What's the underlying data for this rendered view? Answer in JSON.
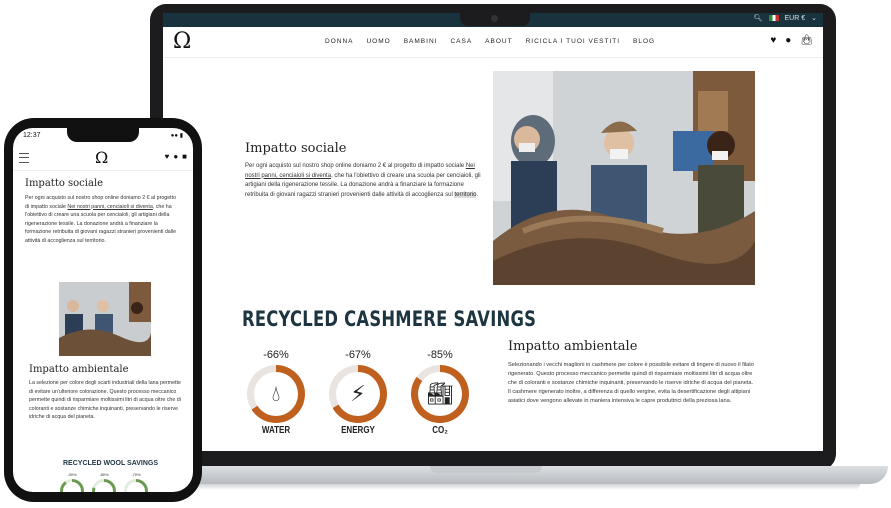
{
  "desktop": {
    "topbar": {
      "lang": "EUR €"
    },
    "nav": {
      "logo": "Ω",
      "items": [
        "DONNA",
        "UOMO",
        "BAMBINI",
        "CASA",
        "ABOUT",
        "RICICLA I TUOI VESTITI",
        "BLOG"
      ]
    },
    "social": {
      "title": "Impatto sociale",
      "text_1": "Per ogni acquisto sul nostro shop online doniamo 2 € al progetto di impatto sociale ",
      "link": "Nei nostri panni, cenciaioli si diventa",
      "text_2": ", che ha l'obiettivo di creare una scuola per cenciaioli, gli artigiani della rigenerazione tessile. La donazione andrà a finanziare la formazione retribuita di giovani ragazzi stranieri provenienti dalle attività di accoglienza sul ",
      "highlight": "territorio",
      "text_3": "."
    },
    "cashmere": {
      "title": "RECYCLED CASHMERE SAVINGS",
      "stats": [
        {
          "pct": "-66%",
          "value": 66,
          "label": "WATER",
          "icon": "water-drops-icon"
        },
        {
          "pct": "-67%",
          "value": 67,
          "label": "ENERGY",
          "icon": "plug-icon"
        },
        {
          "pct": "-85%",
          "value": 85,
          "label": "CO₂",
          "icon": "factory-icon"
        }
      ]
    },
    "environment": {
      "title": "Impatto ambientale",
      "text": "Selezionando i vecchi maglioni in cashmere per colore è possibile evitare di tingere di nuovo il filato rigenerato. Questo processo meccanico permette quindi di risparmiare moltissimi litri di acqua oltre che di coloranti e sostanze chimiche inquinanti, preservando le riserve idriche di acqua del pianeta. Il cashmere rigenerato inoltre, a differenza di quello vergine, evita la desertificazione degli altipiani asiatici dove vengono allevate in maniera intensiva le capre produttrici della preziosa lana."
    }
  },
  "mobile": {
    "time": "12:37",
    "logo": "Ω",
    "social": {
      "title": "Impatto sociale",
      "text_1": "Per ogni acquisto sul nostro shop online doniamo 2 € al progetto di impatto sociale ",
      "link": "Nei nostri panni, cenciaioli si diventa",
      "text_2": ", che ha l'obiettivo di creare una scuola per cenciaioli, gli artigiani della rigenerazione tessile. La donazione andrà a finanziare la formazione retribuita di giovani ragazzi stranieri provenienti dalle attività di accoglienza sul territorio."
    },
    "environment": {
      "title": "Impatto ambientale",
      "text": "La selezione per colore degli scarti industriali della lana permette di evitare un'ulteriore colorazione. Questo processo meccanico permette quindi di risparmiare moltissimi litri di acqua oltre che di coloranti e sostanze chimiche inquinanti, preservando le riserve idriche di acqua del pianeta."
    },
    "wool": {
      "title": "RECYCLED WOOL SAVINGS",
      "stats": [
        {
          "pct": "-90%",
          "value": 90
        },
        {
          "pct": "-80%",
          "value": 80
        },
        {
          "pct": "-70%",
          "value": 70
        }
      ]
    }
  }
}
